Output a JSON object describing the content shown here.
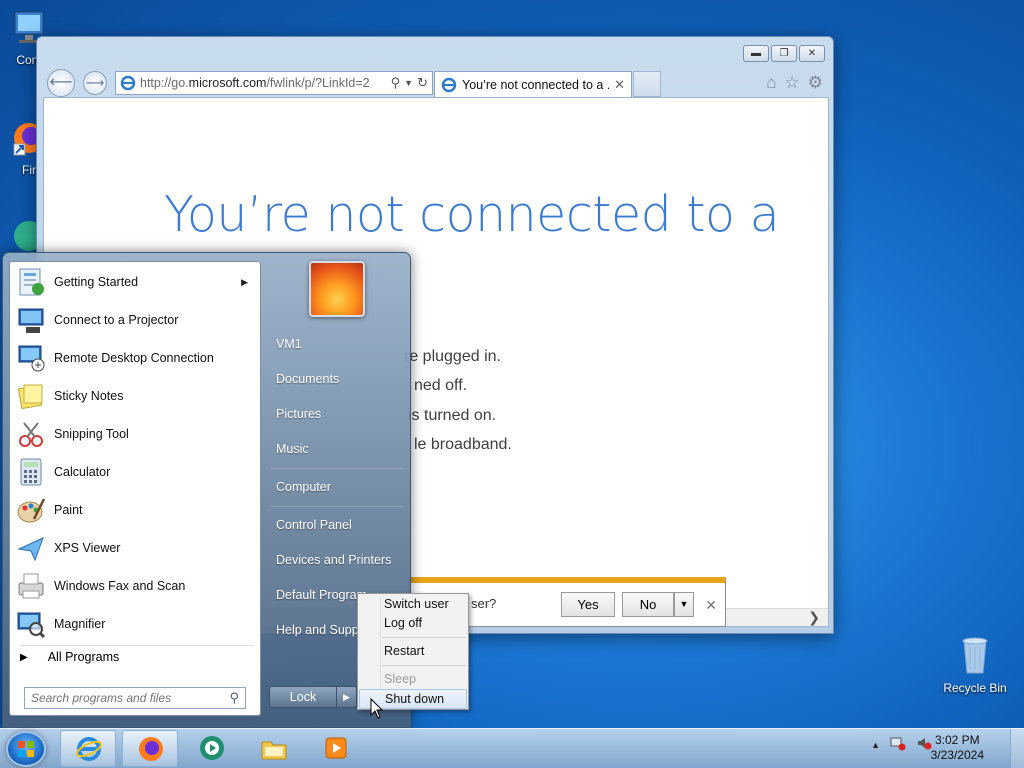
{
  "desktop": {
    "icons": [
      {
        "label": "Com",
        "icon": "computer-icon"
      },
      {
        "label": "Fir",
        "icon": "firefox-shortcut-icon"
      },
      {
        "label": "Recycle Bin",
        "icon": "recycle-bin-icon"
      }
    ]
  },
  "browser": {
    "url_prefix": "http://go.",
    "url_domain": "microsoft.com",
    "url_rest": "/fwlink/p/?LinkId=2",
    "tab_title": "You’re not connected to a ...",
    "headline": "You’re not connected to a",
    "tips": [
      "re plugged in.",
      "ned off.",
      "is turned on.",
      "le broadband."
    ],
    "notification": {
      "question": "ser?",
      "yes_label": "Yes",
      "no_label": "No"
    }
  },
  "start_menu": {
    "programs": [
      {
        "label": "Getting Started",
        "icon": "getting-started-icon",
        "has_submenu": true
      },
      {
        "label": "Connect to a Projector",
        "icon": "projector-icon"
      },
      {
        "label": "Remote Desktop Connection",
        "icon": "remote-desktop-icon"
      },
      {
        "label": "Sticky Notes",
        "icon": "sticky-notes-icon"
      },
      {
        "label": "Snipping Tool",
        "icon": "snipping-tool-icon"
      },
      {
        "label": "Calculator",
        "icon": "calculator-icon"
      },
      {
        "label": "Paint",
        "icon": "paint-icon"
      },
      {
        "label": "XPS Viewer",
        "icon": "xps-viewer-icon"
      },
      {
        "label": "Windows Fax and Scan",
        "icon": "fax-scan-icon"
      },
      {
        "label": "Magnifier",
        "icon": "magnifier-icon"
      }
    ],
    "all_programs": "All Programs",
    "search_placeholder": "Search programs and files",
    "places": [
      "VM1",
      "Documents",
      "Pictures",
      "Music",
      "Computer",
      "Control Panel",
      "Devices and Printers",
      "Default Program",
      "Help and Suppo"
    ],
    "lock_label": "Lock",
    "power_menu": {
      "switch_user": "Switch user",
      "log_off": "Log off",
      "restart": "Restart",
      "sleep": "Sleep",
      "shut_down": "Shut down"
    }
  },
  "taskbar": {
    "time": "3:02 PM",
    "date": "3/23/2024",
    "items": [
      "internet-explorer-icon",
      "firefox-icon",
      "media-center-icon",
      "file-explorer-icon",
      "media-player-icon"
    ]
  }
}
